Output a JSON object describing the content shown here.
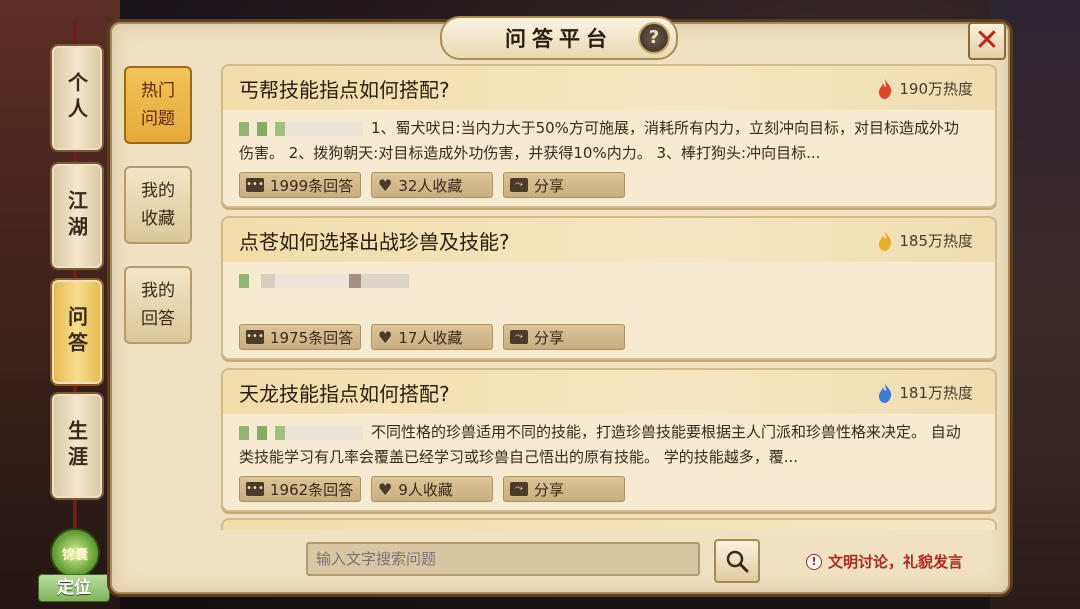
{
  "panel": {
    "title": "问答平台",
    "help_label": "?",
    "close_label": "✕"
  },
  "side_tabs": [
    {
      "label": "个人",
      "active": false
    },
    {
      "label": "江湖",
      "active": false
    },
    {
      "label": "问答",
      "active": true
    },
    {
      "label": "生涯",
      "active": false
    }
  ],
  "locate": {
    "badge": "锦囊",
    "label": "定位"
  },
  "categories": [
    {
      "line1": "热门",
      "line2": "问题",
      "active": true
    },
    {
      "line1": "我的",
      "line2": "收藏",
      "active": false
    },
    {
      "line1": "我的",
      "line2": "回答",
      "active": false
    }
  ],
  "cards": [
    {
      "title": "丐帮技能指点如何搭配?",
      "heat": "190万热度",
      "flame_color": "#e0442a",
      "body": "1、蜀犬吠日:当内力大于50%方可施展，消耗所有内力，立刻冲向目标，对目标造成外功伤害。 2、拨狗朝天:对目标造成外功伤害，并获得10%内力。 3、棒打狗头:冲向目标...",
      "answers": "1999条回答",
      "favorites": "32人收藏",
      "share": "分享"
    },
    {
      "title": "点苍如何选择出战珍兽及技能?",
      "heat": "185万热度",
      "flame_color": "#e8b02a",
      "body": "",
      "answers": "1975条回答",
      "favorites": "17人收藏",
      "share": "分享"
    },
    {
      "title": "天龙技能指点如何搭配?",
      "heat": "181万热度",
      "flame_color": "#3a7ad8",
      "body": "不同性格的珍兽适用不同的技能，打造珍兽技能要根据主人门派和珍兽性格来决定。 自动类技能学习有几率会覆盖已经学习或珍兽自己悟出的原有技能。 学的技能越多，覆...",
      "answers": "1962条回答",
      "favorites": "9人收藏",
      "share": "分享"
    }
  ],
  "search": {
    "placeholder": "输入文字搜索问题"
  },
  "notice": "文明讨论，礼貌发言"
}
